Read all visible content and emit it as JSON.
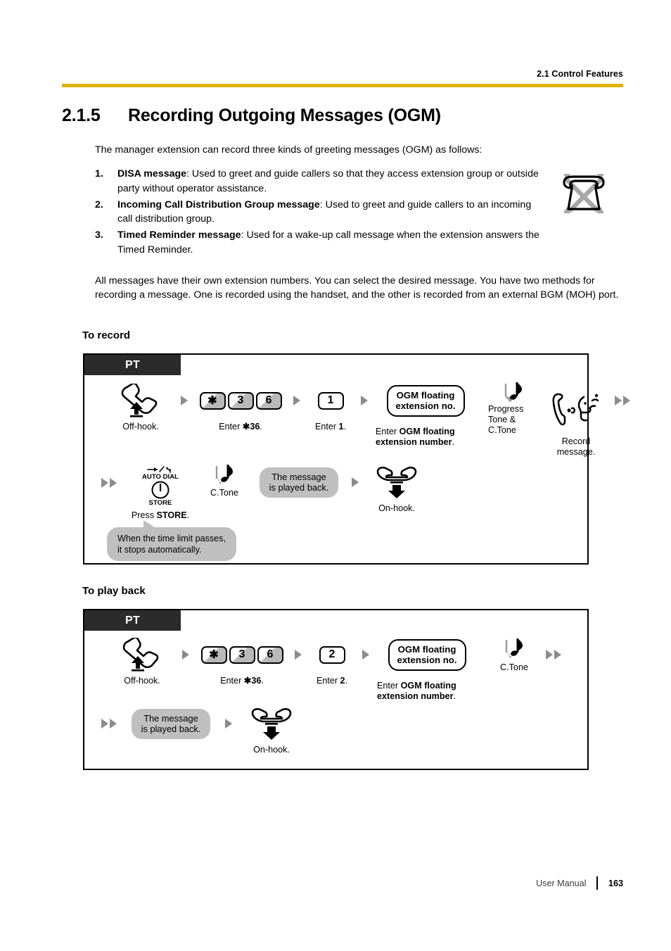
{
  "header": {
    "running_head": "2.1 Control Features",
    "rule_color": "#ddb40a"
  },
  "section": {
    "number": "2.1.5",
    "title": "Recording Outgoing Messages (OGM)"
  },
  "body": {
    "intro": "The manager extension can record three kinds of greeting messages (OGM) as follows:",
    "items": [
      {
        "num": "1.",
        "term": "DISA message",
        "rest": ": Used to greet and guide callers so that they access extension group or outside party without operator assistance."
      },
      {
        "num": "2.",
        "term": "Incoming Call Distribution Group message",
        "rest": ": Used to greet and guide callers to an incoming call distribution group."
      },
      {
        "num": "3.",
        "term": "Timed Reminder message",
        "rest": ": Used for a wake-up call message when the extension answers the Timed Reminder."
      }
    ],
    "closing": "All messages have their own extension numbers. You can select the desired message. You have two methods for recording a message. One is recorded using the handset, and the other is recorded from an external BGM (MOH) port."
  },
  "record": {
    "heading": "To record",
    "pt_label": "PT",
    "steps": [
      {
        "icon": "handset-offhook-icon",
        "label": "Off-hook."
      },
      {
        "icon": "keypad-icon",
        "keys": [
          "✱",
          "3",
          "6"
        ],
        "label_plain": "Enter ",
        "label_bold": "✱36",
        "label_tail": "."
      },
      {
        "icon": "keypad-icon",
        "keys": [
          "1"
        ],
        "label_plain": "Enter ",
        "label_bold": "1",
        "label_tail": "."
      },
      {
        "icon": "pill-box",
        "pill_line1": "OGM floating",
        "pill_line2": "extension no.",
        "label_plain": "Enter ",
        "label_bold": "OGM floating extension number",
        "label_tail": "."
      },
      {
        "icon": "tone-note-icon",
        "label": "Progress\nTone &\nC.Tone"
      },
      {
        "icon": "record-message-icon",
        "label": "Record\nmessage."
      }
    ],
    "steps2": [
      {
        "icon": "auto-dial-store-button-icon",
        "top_label": "AUTO DIAL",
        "bottom_label": "STORE",
        "label_plain": "Press ",
        "label_bold": "STORE",
        "label_tail": "."
      },
      {
        "icon": "tone-note-icon",
        "label": "C.Tone"
      },
      {
        "icon": "gray-bubble",
        "bubble_line1": "The message",
        "bubble_line2": "is played back."
      },
      {
        "icon": "handset-onhook-icon",
        "label": "On-hook."
      }
    ],
    "callout_line1": "When the time limit passes,",
    "callout_line2": "it stops automatically."
  },
  "playback": {
    "heading": "To play back",
    "pt_label": "PT",
    "steps": [
      {
        "icon": "handset-offhook-icon",
        "label": "Off-hook."
      },
      {
        "icon": "keypad-icon",
        "keys": [
          "✱",
          "3",
          "6"
        ],
        "label_plain": "Enter ",
        "label_bold": "✱36",
        "label_tail": "."
      },
      {
        "icon": "keypad-icon",
        "keys": [
          "2"
        ],
        "label_plain": "Enter ",
        "label_bold": "2",
        "label_tail": "."
      },
      {
        "icon": "pill-box",
        "pill_line1": "OGM floating",
        "pill_line2": "extension no.",
        "label_plain": "Enter ",
        "label_bold": "OGM floating extension number",
        "label_tail": "."
      },
      {
        "icon": "tone-note-icon",
        "label": "C.Tone"
      }
    ],
    "steps2": [
      {
        "icon": "gray-bubble",
        "bubble_line1": "The message",
        "bubble_line2": "is played back."
      },
      {
        "icon": "handset-onhook-icon",
        "label": "On-hook."
      }
    ]
  },
  "footer": {
    "label": "User Manual",
    "page": "163"
  }
}
